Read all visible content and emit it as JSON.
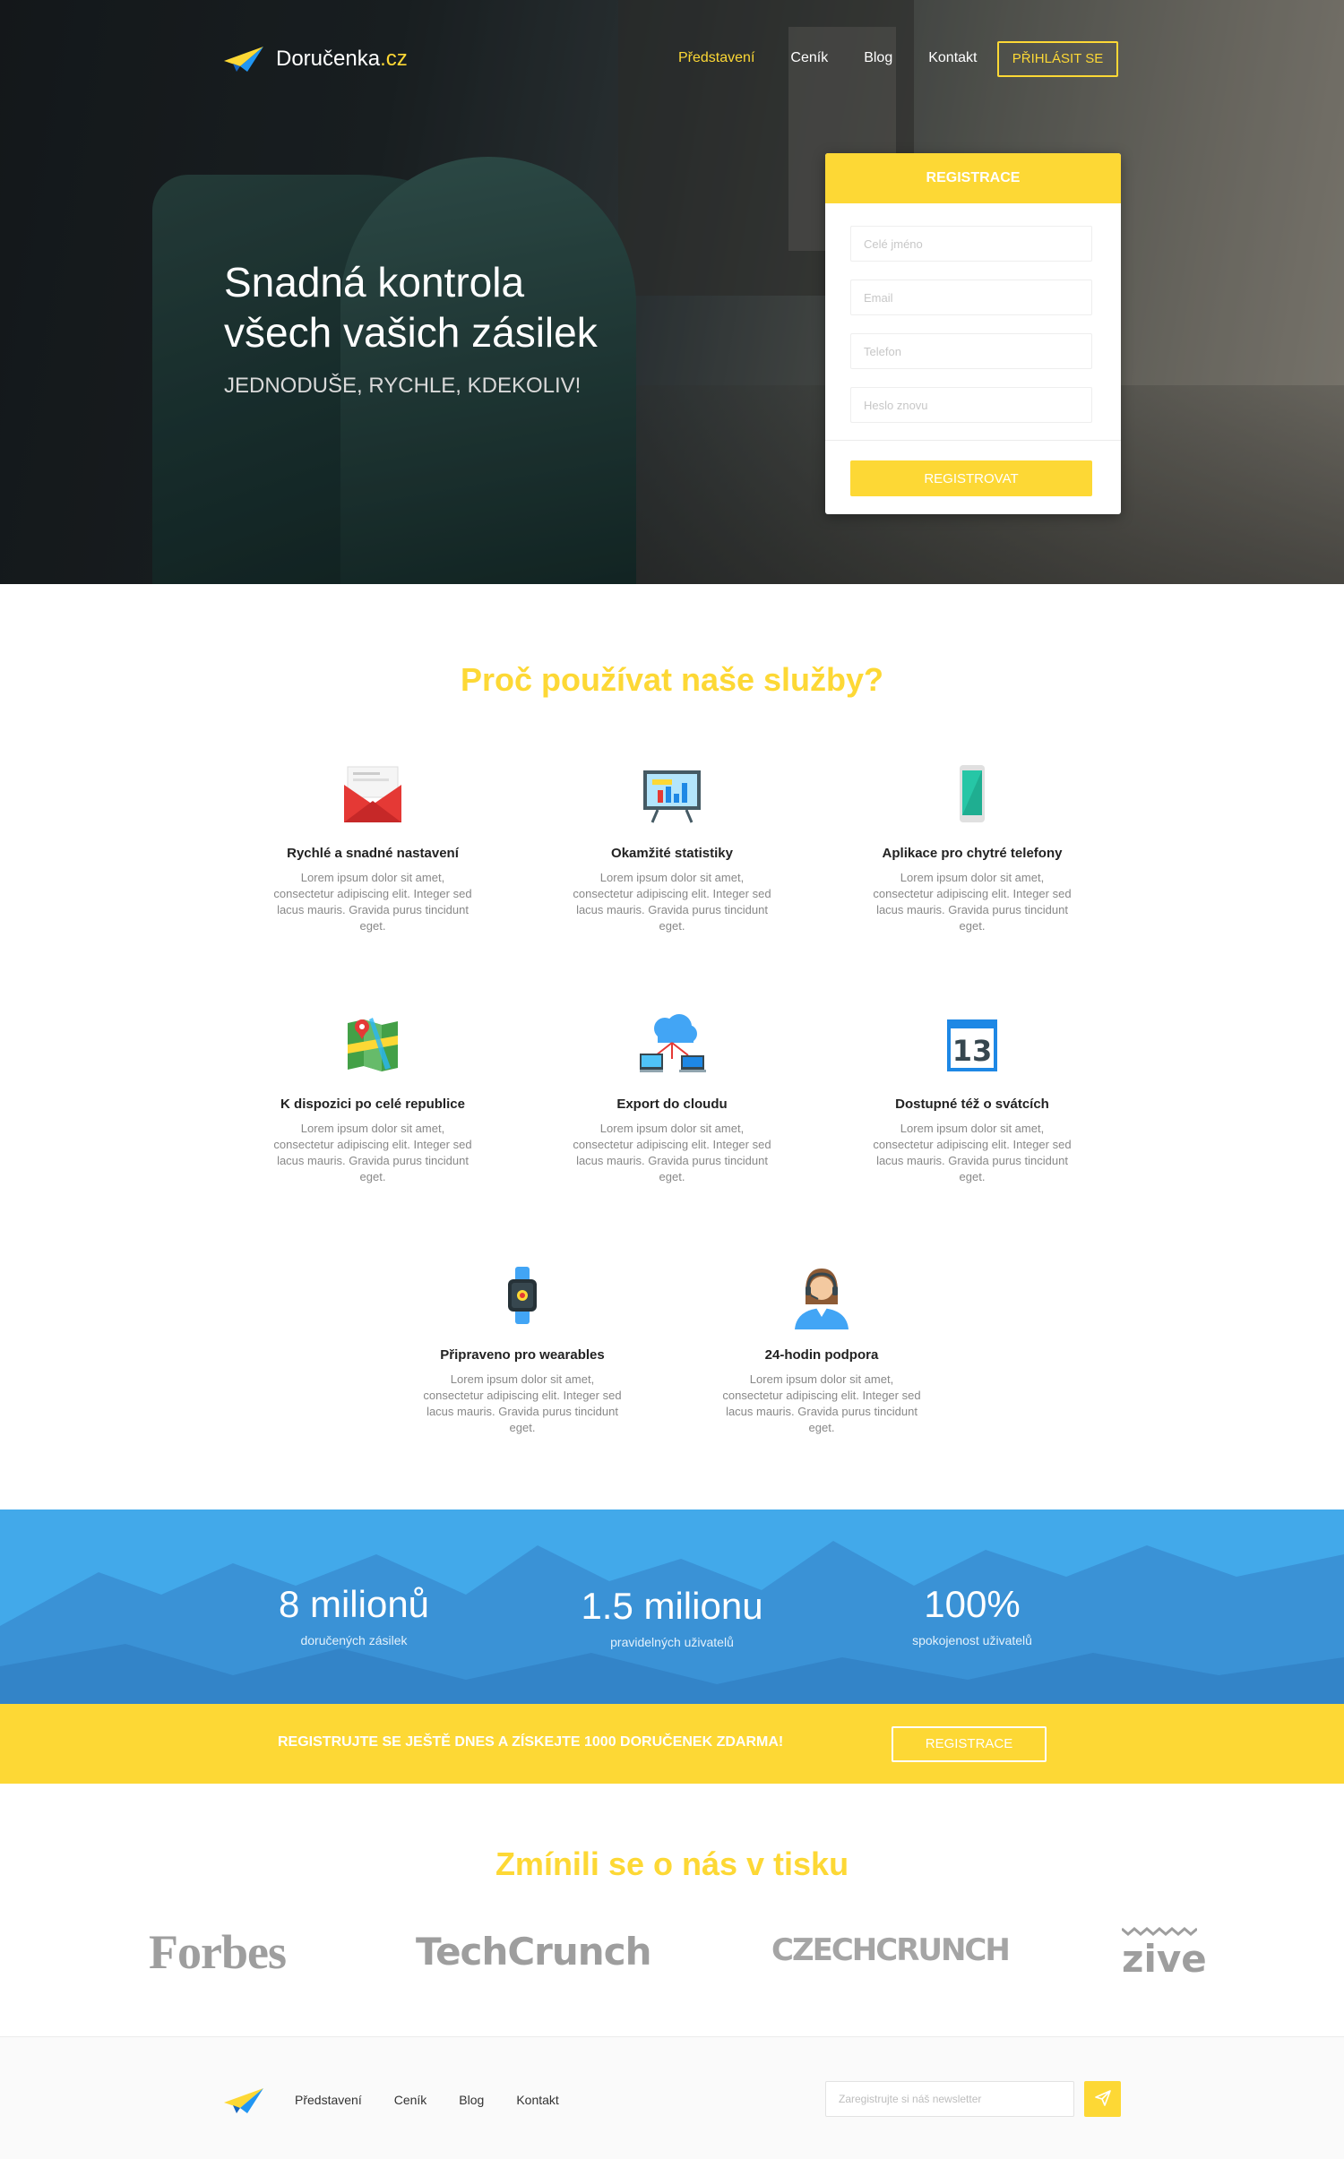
{
  "brand": {
    "name": "Doručenka",
    "tld": ".cz"
  },
  "nav": {
    "links": [
      "Představení",
      "Ceník",
      "Blog",
      "Kontakt"
    ],
    "login": "PŘIHLÁSIT SE"
  },
  "hero": {
    "title_line1": "Snadná kontrola",
    "title_line2": "všech vašich zásilek",
    "subtitle": "JEDNODUŠE, RYCHLE, KDEKOLIV!"
  },
  "registration": {
    "heading": "REGISTRACE",
    "fields": [
      {
        "placeholder": "Celé jméno"
      },
      {
        "placeholder": "Email"
      },
      {
        "placeholder": "Telefon"
      },
      {
        "placeholder": "Heslo znovu"
      }
    ],
    "submit": "REGISTROVAT"
  },
  "features": {
    "title": "Proč používat naše služby?",
    "items": [
      {
        "icon": "envelope-icon",
        "title": "Rychlé a snadné nastavení",
        "text": "Lorem ipsum dolor sit amet, consectetur adipiscing elit. Integer sed lacus mauris. Gravida purus tincidunt eget."
      },
      {
        "icon": "statistics-board-icon",
        "title": "Okamžité statistiky",
        "text": "Lorem ipsum dolor sit amet, consectetur adipiscing elit. Integer sed lacus mauris. Gravida purus tincidunt eget."
      },
      {
        "icon": "smartphone-icon",
        "title": "Aplikace pro chytré telefony",
        "text": "Lorem ipsum dolor sit amet, consectetur adipiscing elit. Integer sed lacus mauris. Gravida purus tincidunt eget."
      },
      {
        "icon": "map-icon",
        "title": "K dispozici po celé republice",
        "text": "Lorem ipsum dolor sit amet, consectetur adipiscing elit. Integer sed lacus mauris. Gravida purus tincidunt eget."
      },
      {
        "icon": "cloud-export-icon",
        "title": "Export do cloudu",
        "text": "Lorem ipsum dolor sit amet, consectetur adipiscing elit. Integer sed lacus mauris. Gravida purus tincidunt eget."
      },
      {
        "icon": "calendar-icon",
        "title": "Dostupné též o svátcích",
        "text": "Lorem ipsum dolor sit amet, consectetur adipiscing elit. Integer sed lacus mauris. Gravida purus tincidunt eget."
      },
      {
        "icon": "smartwatch-icon",
        "title": "Připraveno pro wearables",
        "text": "Lorem ipsum dolor sit amet, consectetur adipiscing elit. Integer sed lacus mauris. Gravida purus tincidunt eget."
      },
      {
        "icon": "support-agent-icon",
        "title": "24-hodin podpora",
        "text": "Lorem ipsum dolor sit amet, consectetur adipiscing elit. Integer sed lacus mauris. Gravida purus tincidunt eget."
      }
    ],
    "calendar_day": "13"
  },
  "stats": [
    {
      "value": "8 milionů",
      "label": "doručených zásilek"
    },
    {
      "value": "1.5 milionu",
      "label": "pravidelných uživatelů"
    },
    {
      "value": "100%",
      "label": "spokojenost uživatelů"
    }
  ],
  "cta": {
    "text": "REGISTRUJTE SE JEŠTĚ DNES A ZÍSKEJTE 1000 DORUČENEK ZDARMA!",
    "button": "REGISTRACE"
  },
  "press": {
    "title": "Zmínili se o nás v tisku",
    "logos": [
      "Forbes",
      "TechCrunch",
      "CZECHCRUNCH",
      "zive"
    ]
  },
  "footer": {
    "links": [
      "Představení",
      "Ceník",
      "Blog",
      "Kontakt"
    ],
    "newsletter_placeholder": "Zaregistrujte si náš newsletter"
  },
  "colors": {
    "accent": "#fdd835",
    "stats_bg": "#42a9ea",
    "mountains": "#3a92d6"
  }
}
